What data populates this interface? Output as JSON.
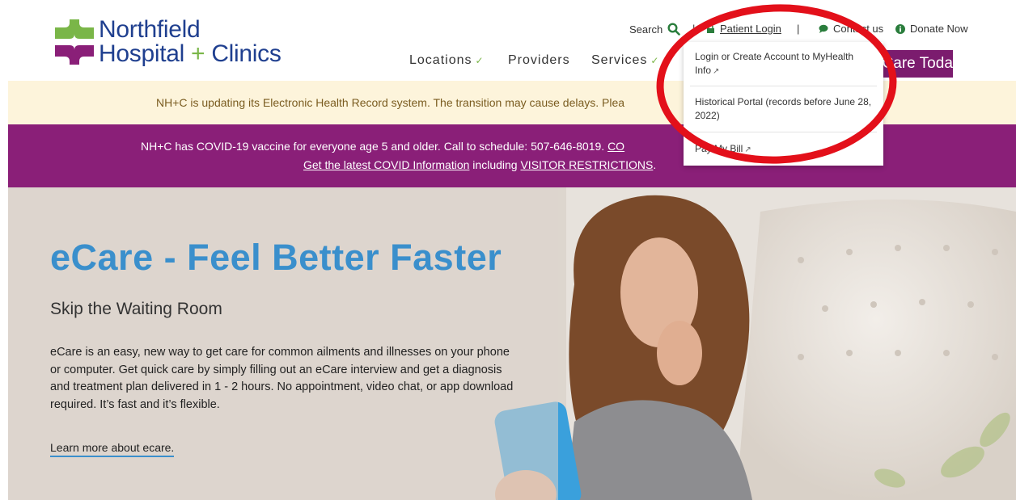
{
  "brand": {
    "line1": "Northfield",
    "line2a": "Hospital",
    "line2b": "+",
    "line2c": "Clinics"
  },
  "utility": {
    "search_label": "Search",
    "patient_login": "Patient Login",
    "divider": "|",
    "contact": "Contact us",
    "donate": "Donate Now"
  },
  "nav": {
    "locations": "Locations",
    "providers": "Providers",
    "services": "Services",
    "cta": "eCare Today"
  },
  "alerts": {
    "ehr": "NH+C is updating its Electronic Health Record system. The transition may cause delays. Plea",
    "covid_line1_text": "NH+C has COVID-19 vaccine for everyone age 5 and older. Call to schedule: 507-646-8019.",
    "covid_line1_link": "CO",
    "covid_line2_link1": "Get the latest COVID Information",
    "covid_line2_mid": " including ",
    "covid_line2_link2": "VISITOR RESTRICTIONS",
    "covid_line2_end": "."
  },
  "hero": {
    "title": "eCare - Feel Better Faster",
    "subtitle": "Skip the Waiting Room",
    "body": "eCare is an easy, new way to get care for common ailments and illnesses on your phone or computer. Get quick care by simply filling out an eCare interview and get a diagnosis and treatment plan delivered in 1 - 2 hours. No appointment, video chat, or app download required. It’s fast and it’s flexible.",
    "link": "Learn more about ecare."
  },
  "dropdown": {
    "item1": "Login or Create Account to MyHealth Info",
    "item2": "Historical Portal (records before June 28, 2022)",
    "item3": "Pay My Bill"
  },
  "colors": {
    "brand_blue": "#1f3f8f",
    "brand_green": "#7ab648",
    "purple": "#8a1f78",
    "hero_blue": "#3a8fcc",
    "annotation_red": "#e3101a"
  }
}
